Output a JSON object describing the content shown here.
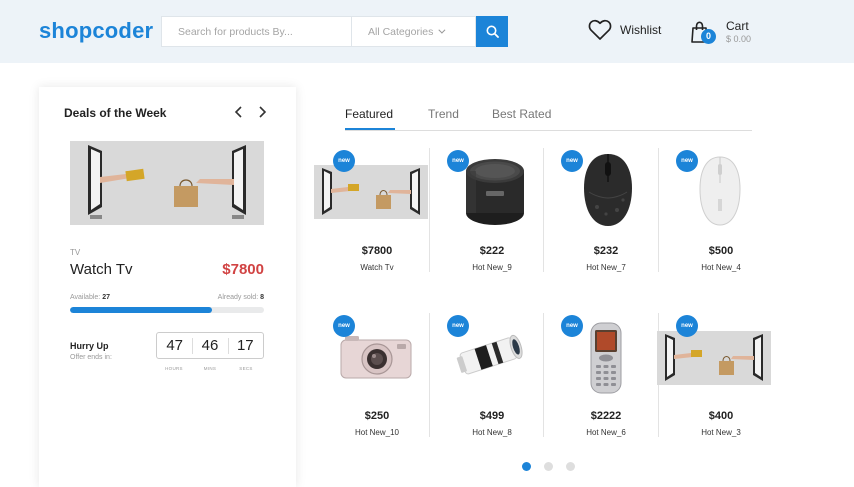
{
  "header": {
    "logo": "shopcoder",
    "search_placeholder": "Search for products By...",
    "category_label": "All Categories",
    "wishlist_label": "Wishlist",
    "cart_label": "Cart",
    "cart_amount": "$ 0.00",
    "cart_count": "0",
    "brand_color": "#1c84d8"
  },
  "deals": {
    "title": "Deals of the Week",
    "category": "TV",
    "name": "Watch Tv",
    "price": "$7800",
    "available_label": "Available:",
    "available": "27",
    "sold_label": "Already sold:",
    "sold": "8",
    "progress_fraction": 0.73,
    "hurry": "Hurry Up",
    "offer_ends": "Offer ends in:",
    "timer": {
      "hours": "47",
      "mins": "46",
      "secs": "17"
    },
    "timer_labels": {
      "hours": "HOURS",
      "mins": "MINS",
      "secs": "SECS"
    },
    "price_color": "#d14343"
  },
  "tabs": [
    {
      "label": "Featured",
      "active": true
    },
    {
      "label": "Trend",
      "active": false
    },
    {
      "label": "Best Rated",
      "active": false
    }
  ],
  "badge_label": "new",
  "products": [
    {
      "price": "$7800",
      "name": "Watch Tv",
      "icon": "online-shopping-image"
    },
    {
      "price": "$222",
      "name": "Hot New_9",
      "icon": "speaker-image"
    },
    {
      "price": "$232",
      "name": "Hot New_7",
      "icon": "mouse-image"
    },
    {
      "price": "$500",
      "name": "Hot New_4",
      "icon": "white-mouse-image"
    },
    {
      "price": "$250",
      "name": "Hot New_10",
      "icon": "camera-image"
    },
    {
      "price": "$499",
      "name": "Hot New_8",
      "icon": "lens-image"
    },
    {
      "price": "$2222",
      "name": "Hot New_6",
      "icon": "phone-image"
    },
    {
      "price": "$400",
      "name": "Hot New_3",
      "icon": "online-shopping-image"
    }
  ],
  "pagination": {
    "count": 3,
    "active": 0
  }
}
